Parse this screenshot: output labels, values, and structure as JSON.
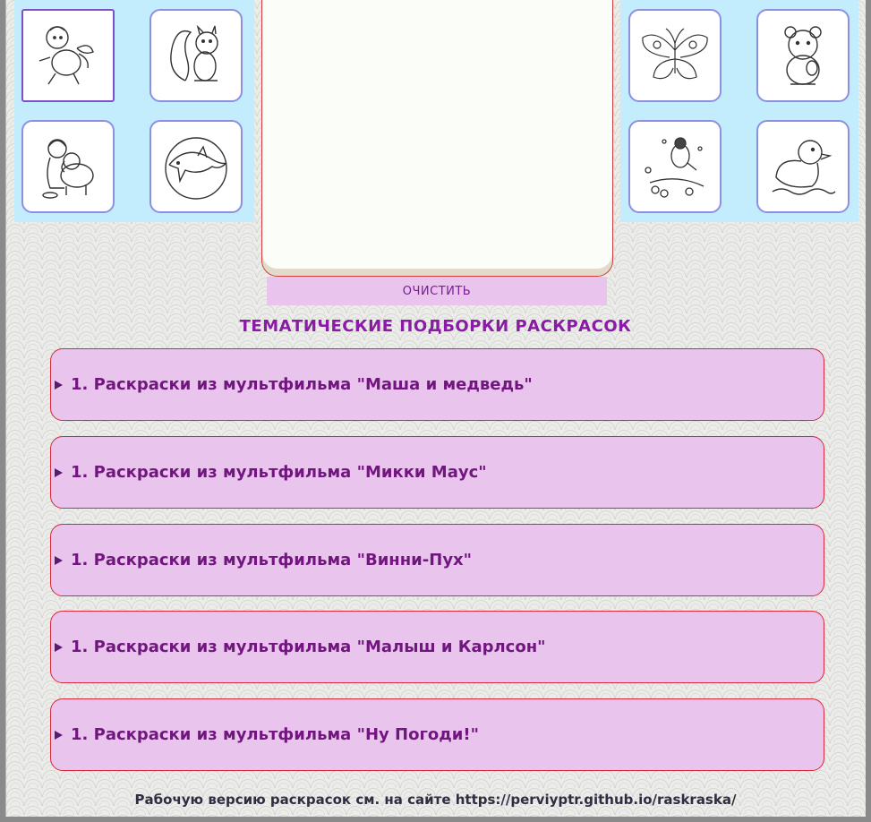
{
  "canvas": {
    "clear_label": "ОЧИСТИТЬ"
  },
  "thumbnails_left": [
    {
      "name": "boy-carlson-icon"
    },
    {
      "name": "squirrel-icon"
    },
    {
      "name": "girl-with-dog-icon"
    },
    {
      "name": "dolphin-icon"
    }
  ],
  "thumbnails_right": [
    {
      "name": "butterfly-icon"
    },
    {
      "name": "hamster-icon"
    },
    {
      "name": "bird-on-branch-icon"
    },
    {
      "name": "duckling-icon"
    }
  ],
  "section": {
    "title": "ТЕМАТИЧЕСКИЕ ПОДБОРКИ РАСКРАСОК"
  },
  "categories": [
    {
      "label": "1. Раскраски из мультфильма \"Маша и медведь\""
    },
    {
      "label": "1. Раскраски из мультфильма \"Микки Маус\""
    },
    {
      "label": "1. Раскраски из мультфильма \"Винни-Пух\""
    },
    {
      "label": "1. Раскраски из мультфильма \"Малыш и Карлсон\""
    },
    {
      "label": "1. Раскраски из мультфильма \"Ну Погоди!\""
    }
  ],
  "footer": {
    "text": "Рабочую версию раскрасок см. на сайте https://perviyptr.github.io/raskraska/"
  },
  "colors": {
    "thumb_panel_bg": "#c3ecfd",
    "category_bg": "#e9c4ec",
    "category_border": "#d7283c",
    "title_color": "#8b1aa6"
  }
}
